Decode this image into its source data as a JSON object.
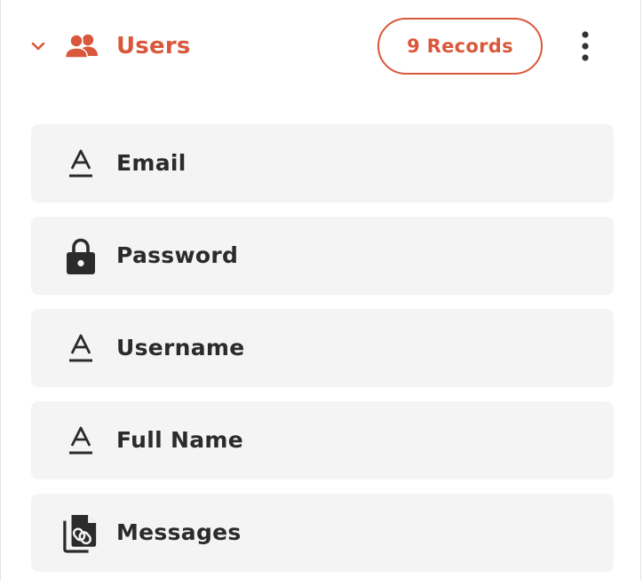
{
  "header": {
    "title": "Users",
    "records_label": "9 Records",
    "accent_color": "#d9573a",
    "icons": {
      "collapse": "chevron-down-icon",
      "group": "users-icon",
      "menu": "kebab-menu-icon"
    }
  },
  "fields": [
    {
      "label": "Email",
      "icon": "text-field-icon"
    },
    {
      "label": "Password",
      "icon": "lock-icon"
    },
    {
      "label": "Username",
      "icon": "text-field-icon"
    },
    {
      "label": "Full Name",
      "icon": "text-field-icon"
    },
    {
      "label": "Messages",
      "icon": "linked-records-icon"
    }
  ]
}
